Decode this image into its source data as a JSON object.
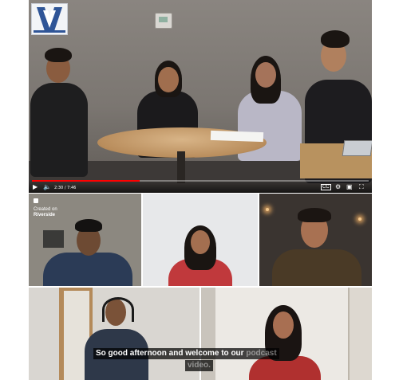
{
  "player": {
    "current_time": "2:30",
    "duration": "7:46",
    "time_display": "2:30 / 7:46",
    "progress_fraction": 0.32,
    "icons": [
      "play-icon",
      "volume-icon",
      "captions-icon",
      "settings-icon",
      "miniplayer-icon",
      "fullscreen-icon"
    ]
  },
  "overlay": {
    "created_on": "Created on",
    "brand": "Riverside"
  },
  "captions": {
    "line1_bright": "So good afternoon and welcome to our",
    "line1_dim": " podcast",
    "line2_dim": "video."
  },
  "colors": {
    "progress": "#ff0000",
    "caption_bg": "#000000"
  }
}
